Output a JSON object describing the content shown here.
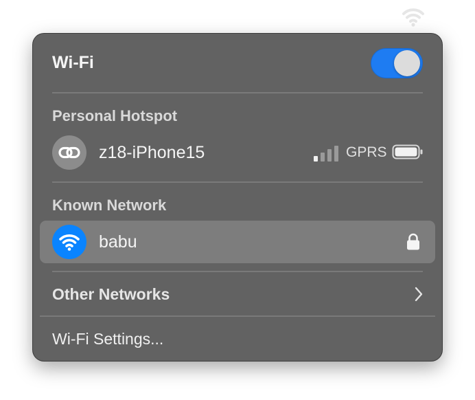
{
  "menubar": {
    "icon": "wifi-icon"
  },
  "wifi_panel": {
    "title": "Wi-Fi",
    "toggle_on": true,
    "accent_color": "#1e7cf2",
    "personal_hotspot": {
      "heading": "Personal Hotspot",
      "device": {
        "name": "z18-iPhone15",
        "icon": "link-icon",
        "signal_bars_total": 4,
        "signal_bars_active": 1,
        "network_type": "GPRS",
        "battery_icon": "battery-icon"
      }
    },
    "known_network": {
      "heading": "Known Network",
      "network": {
        "name": "babu",
        "icon": "wifi-icon",
        "icon_color": "#0a84ff",
        "secured": true,
        "lock_icon": "lock-icon",
        "selected": true
      }
    },
    "other_networks": {
      "label": "Other Networks",
      "icon": "chevron-right-icon"
    },
    "settings": {
      "label": "Wi-Fi Settings..."
    }
  }
}
